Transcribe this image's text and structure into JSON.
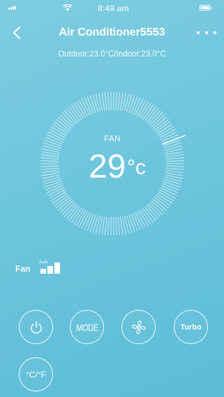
{
  "status_bar": {
    "time": "8:49 am"
  },
  "header": {
    "title": "Air Conditioner5553",
    "back_icon": "chevron-left-icon",
    "more_icon": "more-dots-icon"
  },
  "temps_info": "Outdoor:23.0°C/Indoor:23.0°C",
  "dial": {
    "mode": "FAN",
    "temperature": "29",
    "unit": "°c"
  },
  "fan_speed": {
    "label": "Fan",
    "auto_label": "Auto",
    "level": 3,
    "max_level": 3
  },
  "controls": {
    "power_icon": "power-icon",
    "mode_label": "MODE",
    "fan_icon": "fan-icon",
    "turbo_label": "Turbo",
    "unit_label": "°C/°F"
  },
  "colors": {
    "background_top": "#7ecde0",
    "background_bottom": "#5cbcd7",
    "foreground": "#ffffff"
  }
}
